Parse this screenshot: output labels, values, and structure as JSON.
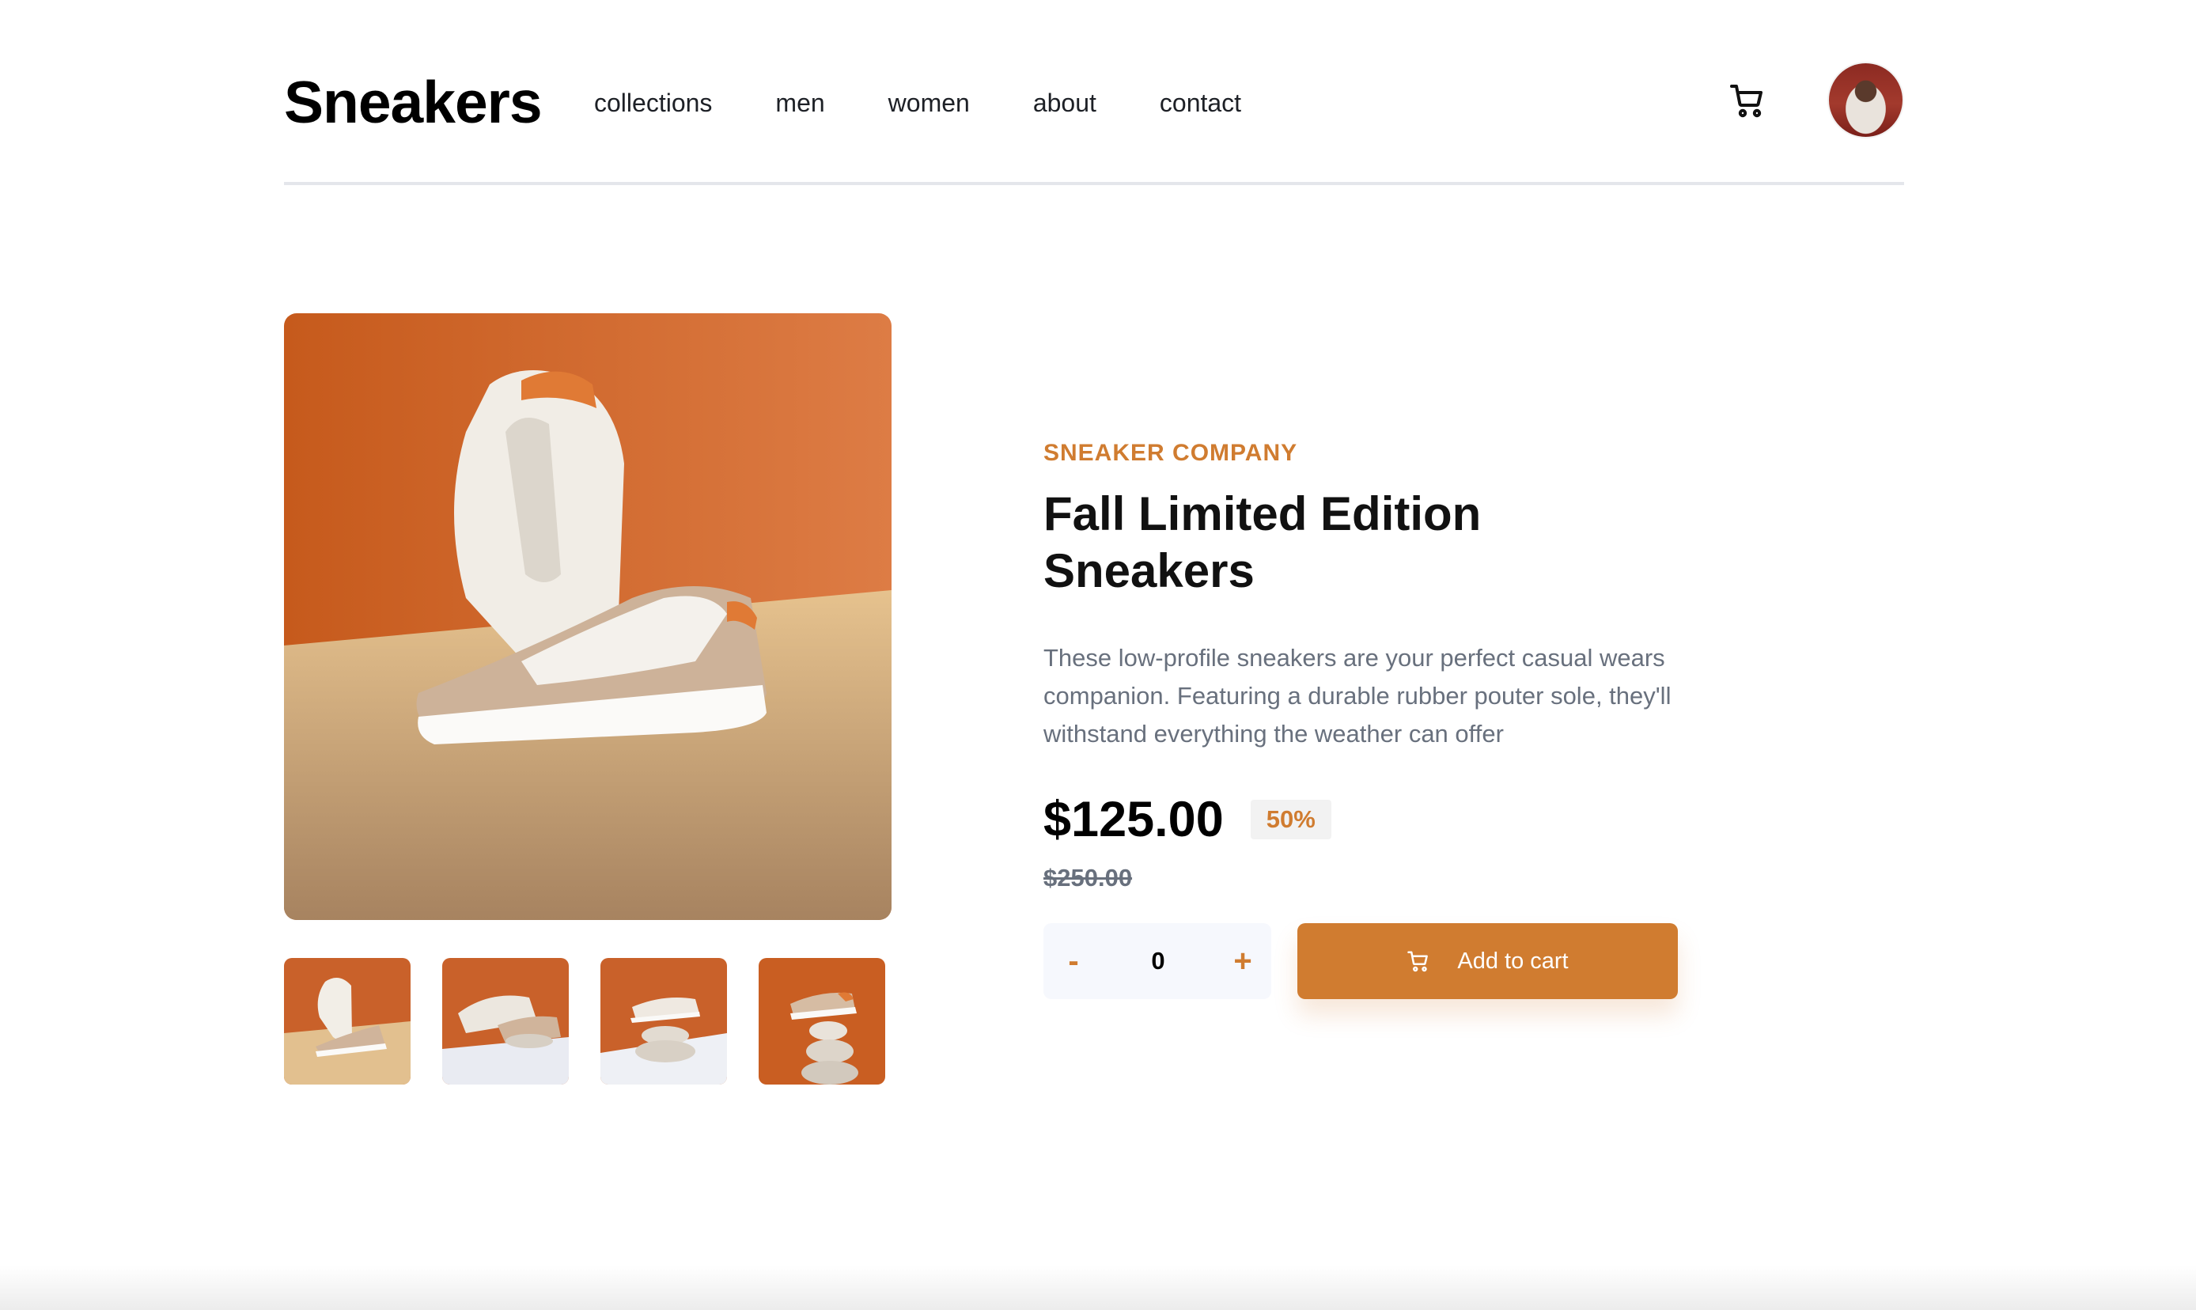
{
  "header": {
    "logo": "Sneakers",
    "nav": [
      "collections",
      "men",
      "women",
      "about",
      "contact"
    ],
    "cart_icon": "cart-icon",
    "avatar_icon": "avatar"
  },
  "product": {
    "company": "SNEAKER COMPANY",
    "title": "Fall Limited Edition Sneakers",
    "description": "These low-profile sneakers are your perfect casual wears companion. Featuring a durable rubber pouter sole, they'll withstand everything the weather can offer",
    "price": "$125.00",
    "discount": "50%",
    "old_price": "$250.00",
    "quantity": "0",
    "minus": "-",
    "plus": "+",
    "add_to_cart": "Add to cart"
  },
  "colors": {
    "accent": "#d07c30",
    "text_dark": "#1d2026",
    "text_muted": "#68707d",
    "light_bg": "#f6f8fd"
  }
}
